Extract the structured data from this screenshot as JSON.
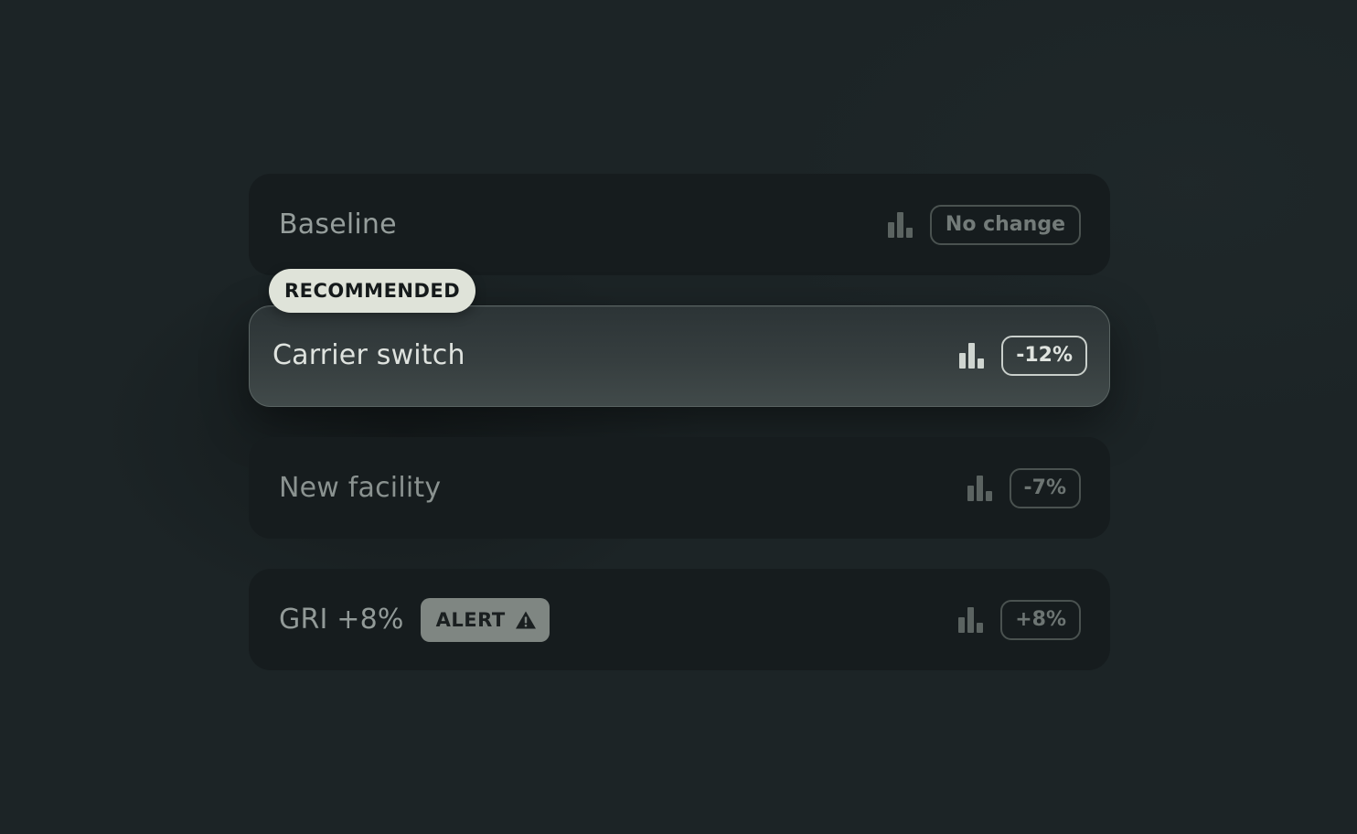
{
  "scenarios": [
    {
      "name": "Baseline",
      "change": "No change",
      "icon": "bar-chart-icon"
    },
    {
      "name": "Carrier switch",
      "change": "-12%",
      "icon": "bar-chart-icon",
      "badge": "RECOMMENDED",
      "selected": true
    },
    {
      "name": "New facility",
      "change": "-7%",
      "icon": "bar-chart-icon"
    },
    {
      "name": "GRI +8%",
      "change": "+8%",
      "icon": "bar-chart-icon",
      "alert": {
        "label": "ALERT",
        "icon": "warning-icon"
      }
    }
  ],
  "colors": {
    "background": "#1c2426",
    "row": "#161c1e",
    "selected_row": "#363e3f",
    "recommended_badge": "#dfe3d9",
    "alert_badge": "#7f8682"
  }
}
